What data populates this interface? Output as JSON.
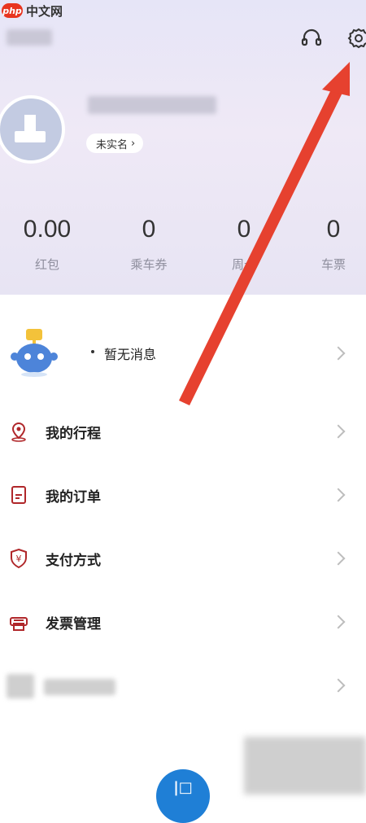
{
  "watermark": {
    "logo": "php",
    "text": "中文网"
  },
  "profile": {
    "verify_label": "未实名"
  },
  "stats": [
    {
      "value": "0.00",
      "label": "红包"
    },
    {
      "value": "0",
      "label": "乘车券"
    },
    {
      "value": "0",
      "label": "周卡"
    },
    {
      "value": "0",
      "label": "车票"
    }
  ],
  "message": {
    "text": "暂无消息"
  },
  "menu": [
    {
      "label": "我的行程",
      "icon": "location-pin-icon"
    },
    {
      "label": "我的订单",
      "icon": "order-document-icon"
    },
    {
      "label": "支付方式",
      "icon": "yuan-shield-icon"
    },
    {
      "label": "发票管理",
      "icon": "printer-icon"
    }
  ],
  "fab": {
    "label": "|□"
  },
  "colors": {
    "accent": "#1f7fd6",
    "arrow": "#e6412f",
    "brand_icon": "#b0272a"
  }
}
